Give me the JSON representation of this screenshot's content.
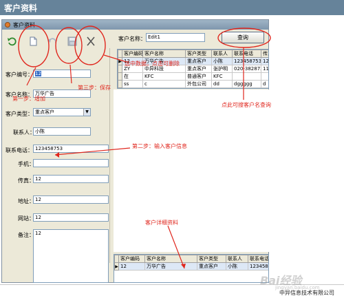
{
  "app": {
    "title": "客户资料"
  },
  "window": {
    "title": "客户资料"
  },
  "toolbar": {
    "buttons": [
      {
        "label": "刷新",
        "icon": "refresh-icon",
        "enabled": true
      },
      {
        "label": "增加",
        "icon": "add-document-icon",
        "enabled": true
      },
      {
        "label": "取消",
        "icon": "undo-icon",
        "enabled": false
      },
      {
        "label": "保存",
        "icon": "save-icon",
        "enabled": false
      },
      {
        "label": "删除",
        "icon": "delete-icon",
        "enabled": true
      }
    ]
  },
  "form": {
    "code": {
      "label": "客户编号：",
      "value": "12"
    },
    "name": {
      "label": "客户名称：",
      "value": "万华广告"
    },
    "type": {
      "label": "客户类型：",
      "value": "重点客户"
    },
    "contact": {
      "label": "联系人：",
      "value": "小陈"
    },
    "phone": {
      "label": "联系电话：",
      "value": "123458753"
    },
    "mobile": {
      "label": "手机：",
      "value": ""
    },
    "fax": {
      "label": "传真：",
      "value": "12"
    },
    "address": {
      "label": "地址：",
      "value": "12"
    },
    "website": {
      "label": "网站：",
      "value": "12"
    },
    "remark": {
      "label": "备注：",
      "value": "12"
    }
  },
  "search": {
    "label": "客户名称：",
    "value": "Edit1",
    "button_label": "查询"
  },
  "top_grid": {
    "columns": [
      "客户编码",
      "客户名称",
      "客户类型",
      "联系人",
      "联系电话",
      "传真"
    ],
    "rows": [
      [
        "12",
        "万华广告",
        "重点客户",
        "小陈",
        "123458753",
        "12"
      ],
      [
        "ZY",
        "中异科技",
        "重点客户",
        "张护明",
        "020-3828737",
        "110"
      ],
      [
        "在",
        "KFC",
        "普通客户",
        "KFC",
        "",
        ""
      ],
      [
        "ss",
        "c",
        "外包公司",
        "dd",
        "dggggg",
        "d"
      ]
    ],
    "selected_row": 0
  },
  "bottom_grid": {
    "columns": [
      "客户编码",
      "客户名称",
      "客户类型",
      "联系人",
      "联系电话"
    ],
    "rows": [
      [
        "12",
        "万华广告",
        "重点客户",
        "小陈",
        "123458753"
      ]
    ]
  },
  "annotations": {
    "step1": "第一步：增加",
    "step2": "第二步：输入客户信息",
    "step3": "第三步：保存",
    "delete_hint": "选中数据，点击可删除",
    "search_hint": "点此可搜客户名查询",
    "detail_hint": "客户详细资料"
  },
  "footer": {
    "company": "中异信息技术有限公司"
  },
  "watermark": {
    "brand": "Bai经验",
    "sub": "jingyan.baidu.com"
  },
  "colors": {
    "titlebar": "#66839a",
    "annotation": "#e0261d",
    "selection": "#316ac5"
  }
}
